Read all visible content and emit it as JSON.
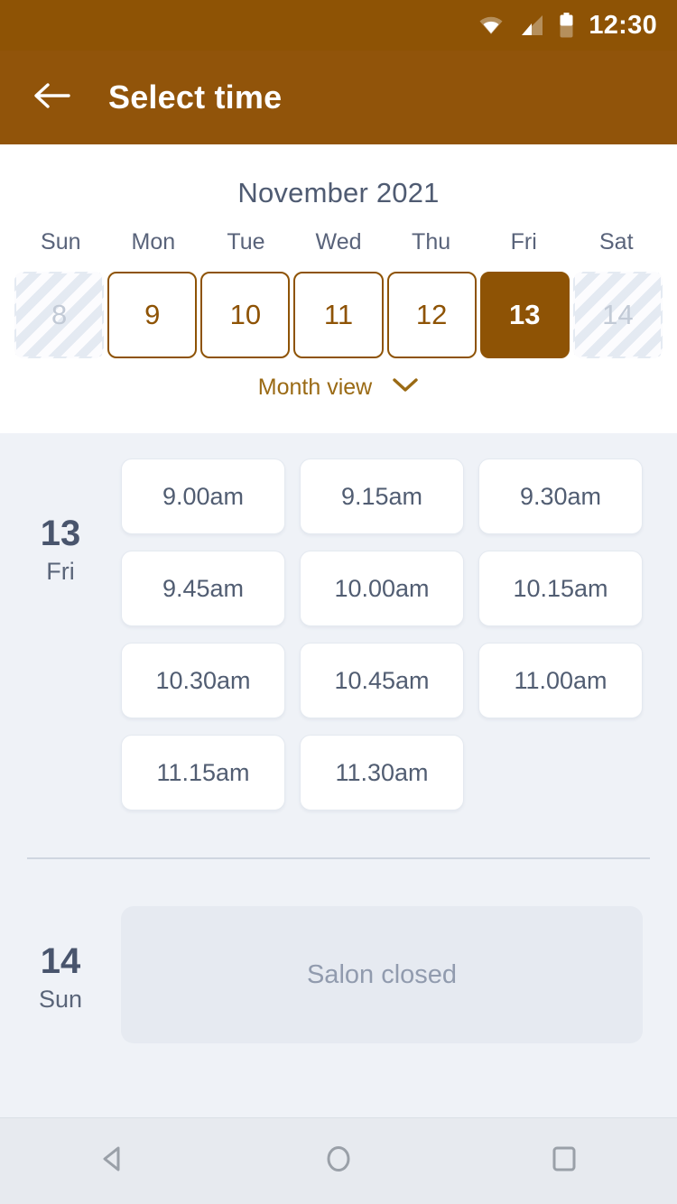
{
  "status_bar": {
    "time": "12:30",
    "icons": [
      "wifi-icon",
      "cellular-signal-icon",
      "battery-icon"
    ]
  },
  "app_bar": {
    "back_icon": "arrow-left-icon",
    "title": "Select time"
  },
  "calendar": {
    "month_title": "November 2021",
    "weekdays": [
      "Sun",
      "Mon",
      "Tue",
      "Wed",
      "Thu",
      "Fri",
      "Sat"
    ],
    "days": [
      {
        "number": "8",
        "state": "disabled"
      },
      {
        "number": "9",
        "state": "available"
      },
      {
        "number": "10",
        "state": "available"
      },
      {
        "number": "11",
        "state": "available"
      },
      {
        "number": "12",
        "state": "available"
      },
      {
        "number": "13",
        "state": "selected"
      },
      {
        "number": "14",
        "state": "disabled"
      }
    ],
    "month_view": {
      "label": "Month view",
      "icon": "chevron-down-icon"
    }
  },
  "schedule": {
    "groups": [
      {
        "date_number": "13",
        "date_weekday": "Fri",
        "closed": false,
        "closed_message": "",
        "slots": [
          "9.00am",
          "9.15am",
          "9.30am",
          "9.45am",
          "10.00am",
          "10.15am",
          "10.30am",
          "10.45am",
          "11.00am",
          "11.15am",
          "11.30am"
        ]
      },
      {
        "date_number": "14",
        "date_weekday": "Sun",
        "closed": true,
        "closed_message": "Salon closed",
        "slots": []
      }
    ]
  },
  "nav_bar": {
    "buttons": [
      "back-nav-icon",
      "home-nav-icon",
      "recents-nav-icon"
    ]
  },
  "colors": {
    "brand_brown": "#8E5305",
    "appbar_brown": "#91540A",
    "page_background": "#EFF2F7",
    "text_slate": "#4F5B72",
    "muted_slate": "#919BAE"
  }
}
